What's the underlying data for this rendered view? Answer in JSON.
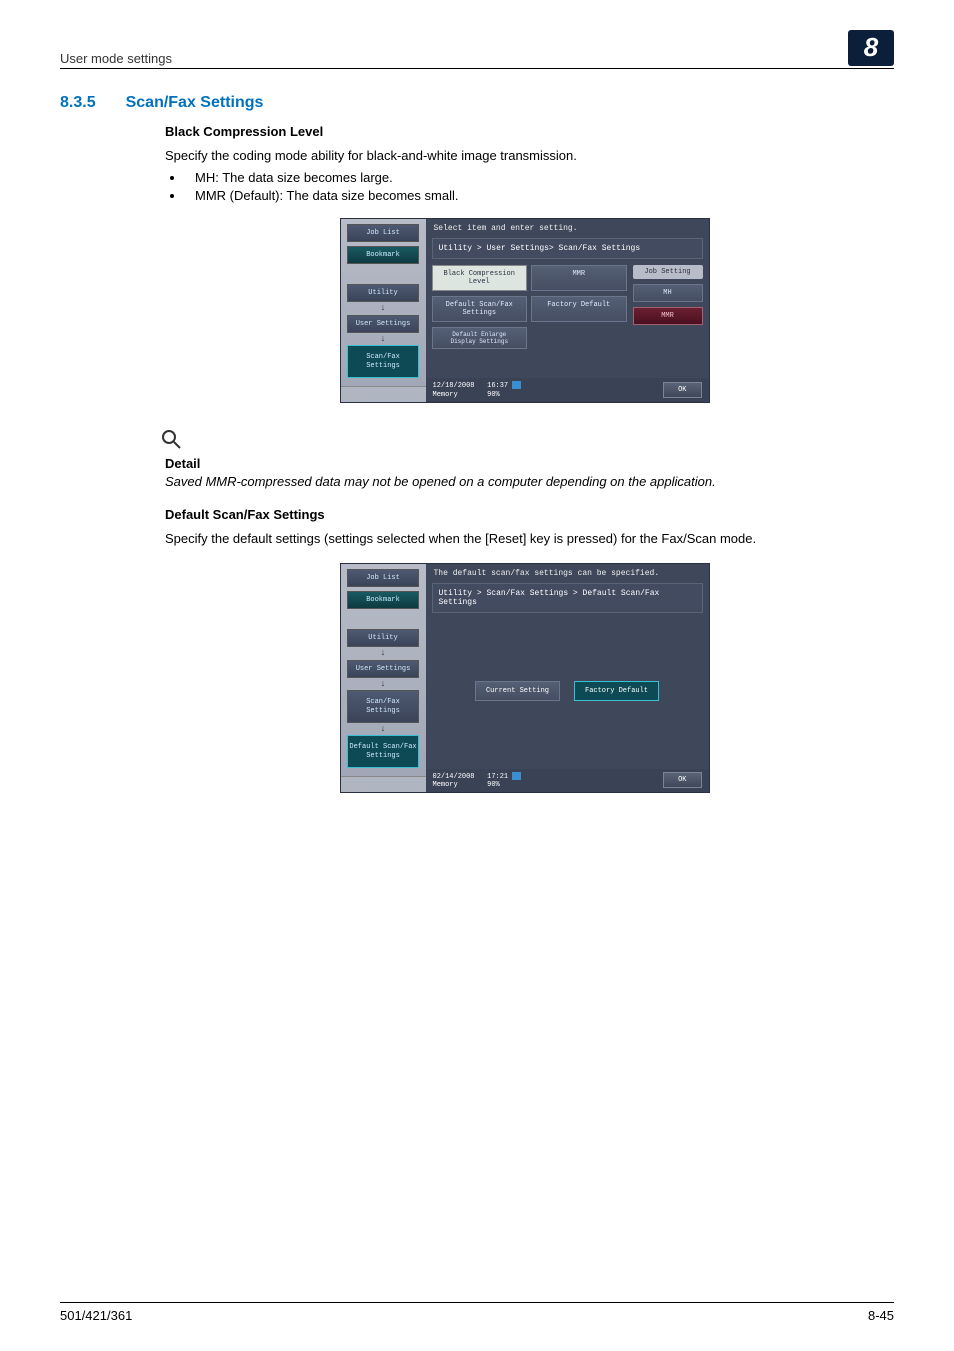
{
  "header": {
    "breadcrumb": "User mode settings",
    "chapter": "8"
  },
  "section": {
    "number": "8.3.5",
    "title": "Scan/Fax Settings"
  },
  "block1": {
    "heading": "Black Compression Level",
    "intro": "Specify the coding mode ability for black-and-white image transmission.",
    "bullets": [
      "MH: The data size becomes large.",
      "MMR (Default): The data size becomes small."
    ]
  },
  "detail": {
    "label": "Detail",
    "text": "Saved MMR-compressed data may not be opened on a computer depending on the application."
  },
  "block2": {
    "heading": "Default Scan/Fax Settings",
    "intro": "Specify the default settings (settings selected when the [Reset] key is pressed) for the Fax/Scan mode."
  },
  "screen1": {
    "job_list": "Job List",
    "bookmark": "Bookmark",
    "nav": {
      "utility": "Utility",
      "user_settings": "User Settings",
      "scanfax": "Scan/Fax\nSettings"
    },
    "top": "Select item and enter setting.",
    "crumb": "Utility > User Settings> Scan/Fax Settings",
    "btns": {
      "b1a": "Black Compression Level",
      "b1b": "MMR",
      "b2a": "Default Scan/Fax Settings",
      "b2b": "Factory Default",
      "b3": "Default Enlarge\nDisplay Settings"
    },
    "side": {
      "label": "Job Setting",
      "mh": "MH",
      "mmr": "MMR"
    },
    "status": {
      "date": "12/18/2008",
      "time": "16:37",
      "mem": "Memory",
      "pct": "90%",
      "ok": "OK"
    }
  },
  "screen2": {
    "job_list": "Job List",
    "bookmark": "Bookmark",
    "nav": {
      "utility": "Utility",
      "user_settings": "User Settings",
      "scanfax": "Scan/Fax\nSettings",
      "default": "Default Scan/Fax\nSettings"
    },
    "top": "The default scan/fax settings can be specified.",
    "crumb": "Utility > Scan/Fax Settings > Default Scan/Fax Settings",
    "btns": {
      "current": "Current Setting",
      "factory": "Factory Default"
    },
    "status": {
      "date": "02/14/2008",
      "time": "17:21",
      "mem": "Memory",
      "pct": "90%",
      "ok": "OK"
    }
  },
  "footer": {
    "left": "501/421/361",
    "right": "8-45"
  }
}
